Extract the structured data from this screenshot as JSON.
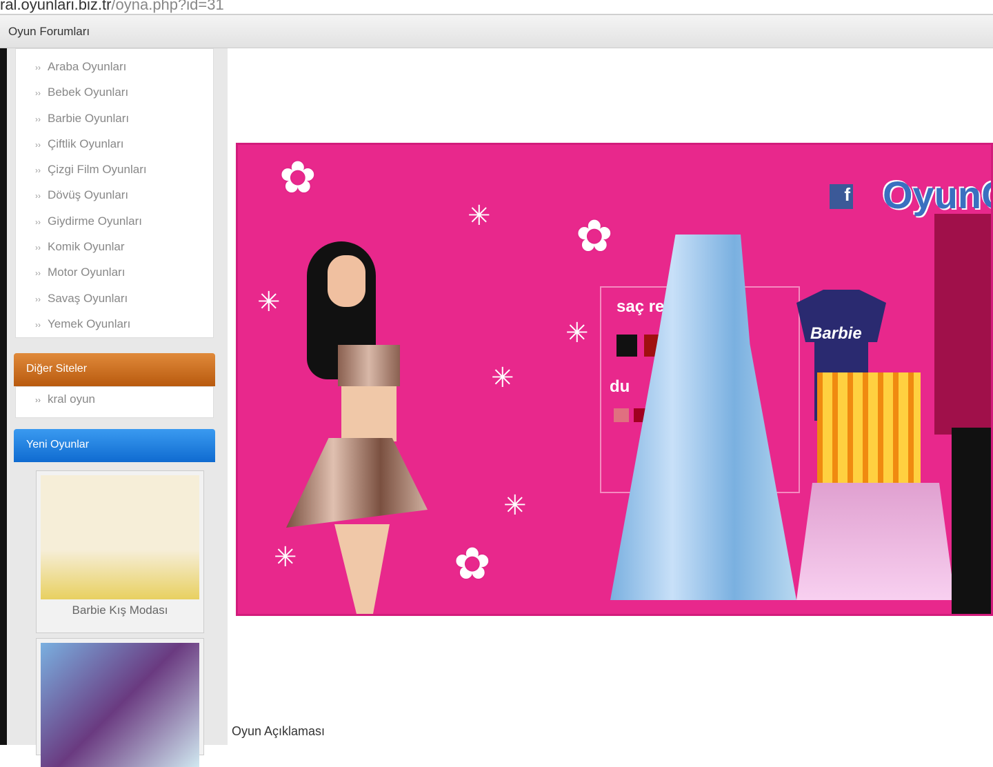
{
  "browser": {
    "url_domain": "ral.oyunlari.biz.tr",
    "url_path": "/oyna.php?id=31",
    "bookmark": "Oyun Forumları"
  },
  "sidebar": {
    "categories": [
      "Araba Oyunları",
      "Bebek Oyunları",
      "Barbie Oyunları",
      "Çiftlik Oyunları",
      "Çizgi Film Oyunları",
      "Dövüş Oyunları",
      "Giydirme Oyunları",
      "Komik Oyunlar",
      "Motor Oyunları",
      "Savaş Oyunları",
      "Yemek Oyunları"
    ],
    "other_sites_title": "Diğer Siteler",
    "other_sites": [
      "kral oyun"
    ],
    "new_games_title": "Yeni Oyunlar",
    "new_games": [
      "Barbie Kış Modası",
      ""
    ]
  },
  "game": {
    "logo": "OyunGe",
    "hair_label": "saç re",
    "label2": "du",
    "shirt_text": "Barbie",
    "hair_colors": [
      "#111111",
      "#a01010",
      "#a0600a",
      "#e8d0a0"
    ],
    "colors2": [
      "#e07080",
      "#a00020",
      "#6010a0",
      "#f0a0a0",
      "#a06050",
      "#e080e0"
    ]
  },
  "description": {
    "title": "Oyun Açıklaması"
  }
}
